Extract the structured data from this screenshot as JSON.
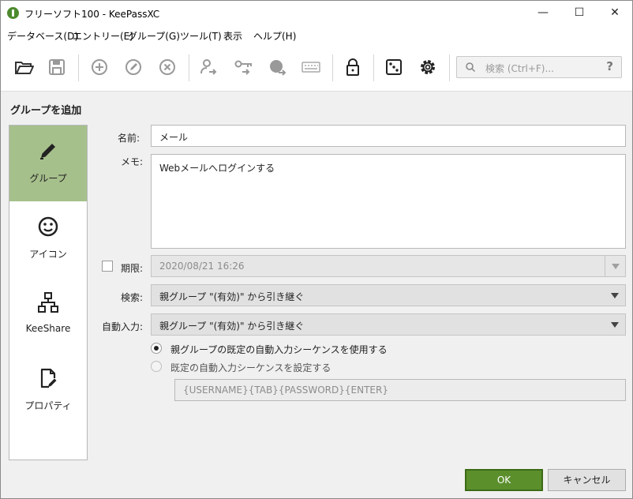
{
  "window": {
    "title": "フリーソフト100 - KeePassXC",
    "minimize": "—",
    "maximize": "☐",
    "close": "✕"
  },
  "menu": [
    "データベース(D)",
    "エントリー(E)",
    "グループ(G)",
    "ツール(T)",
    "表示",
    "ヘルプ(H)"
  ],
  "toolbar": {
    "icons": [
      "open-database-icon",
      "save-database-icon",
      "add-entry-icon",
      "edit-entry-icon",
      "delete-entry-icon",
      "copy-username-icon",
      "copy-password-icon",
      "copy-url-icon",
      "autotype-icon",
      "lock-database-icon",
      "password-generator-icon",
      "settings-icon"
    ],
    "search_placeholder": "検索 (Ctrl+F)...",
    "search_help": "?"
  },
  "page_title": "グループを追加",
  "categories": [
    {
      "label": "グループ",
      "icon": "pencil-icon",
      "active": true
    },
    {
      "label": "アイコン",
      "icon": "smiley-icon",
      "active": false
    },
    {
      "label": "KeeShare",
      "icon": "network-icon",
      "active": false
    },
    {
      "label": "プロパティ",
      "icon": "document-edit-icon",
      "active": false
    }
  ],
  "form": {
    "name_label": "名前:",
    "name_value": "メール",
    "notes_label": "メモ:",
    "notes_value": "Webメールへログインする",
    "expires_label": "期限:",
    "expires_checked": false,
    "expires_value": "2020/08/21 16:26",
    "search_label": "検索:",
    "search_value": "親グループ \"(有効)\" から引き継ぐ",
    "autotype_label": "自動入力:",
    "autotype_value": "親グループ \"(有効)\" から引き継ぐ",
    "radio_inherit_label": "親グループの既定の自動入力シーケンスを使用する",
    "radio_custom_label": "既定の自動入力シーケンスを設定する",
    "sequence_value": "{USERNAME}{TAB}{PASSWORD}{ENTER}"
  },
  "buttons": {
    "ok": "OK",
    "cancel": "キャンセル"
  },
  "colors": {
    "accent_green": "#5a8f2c",
    "active_category": "#a6c08c"
  }
}
